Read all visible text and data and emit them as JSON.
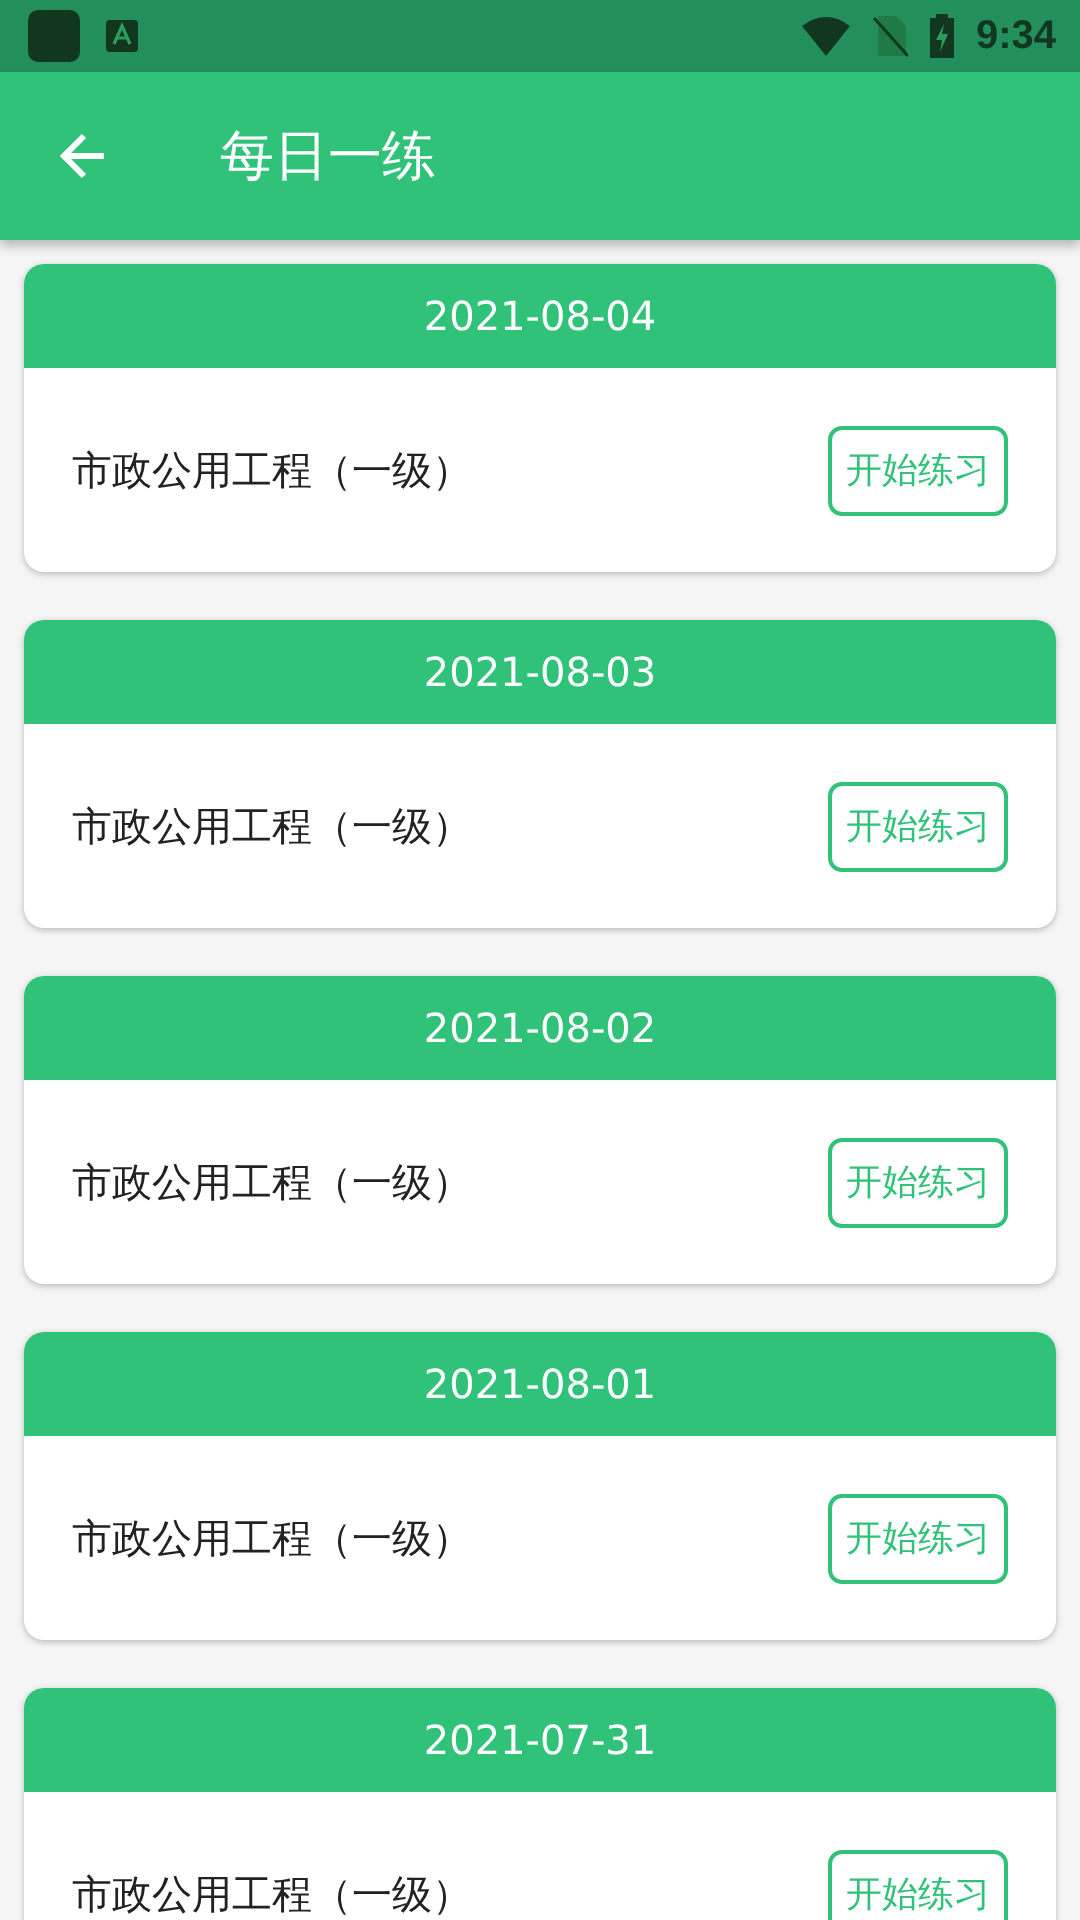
{
  "status_bar": {
    "time": "9:34"
  },
  "app_bar": {
    "title": "每日一练"
  },
  "cards": [
    {
      "date": "2021-08-04",
      "subject": "市政公用工程（一级）",
      "button": "开始练习"
    },
    {
      "date": "2021-08-03",
      "subject": "市政公用工程（一级）",
      "button": "开始练习"
    },
    {
      "date": "2021-08-02",
      "subject": "市政公用工程（一级）",
      "button": "开始练习"
    },
    {
      "date": "2021-08-01",
      "subject": "市政公用工程（一级）",
      "button": "开始练习"
    },
    {
      "date": "2021-07-31",
      "subject": "市政公用工程（一级）",
      "button": "开始练习"
    }
  ]
}
